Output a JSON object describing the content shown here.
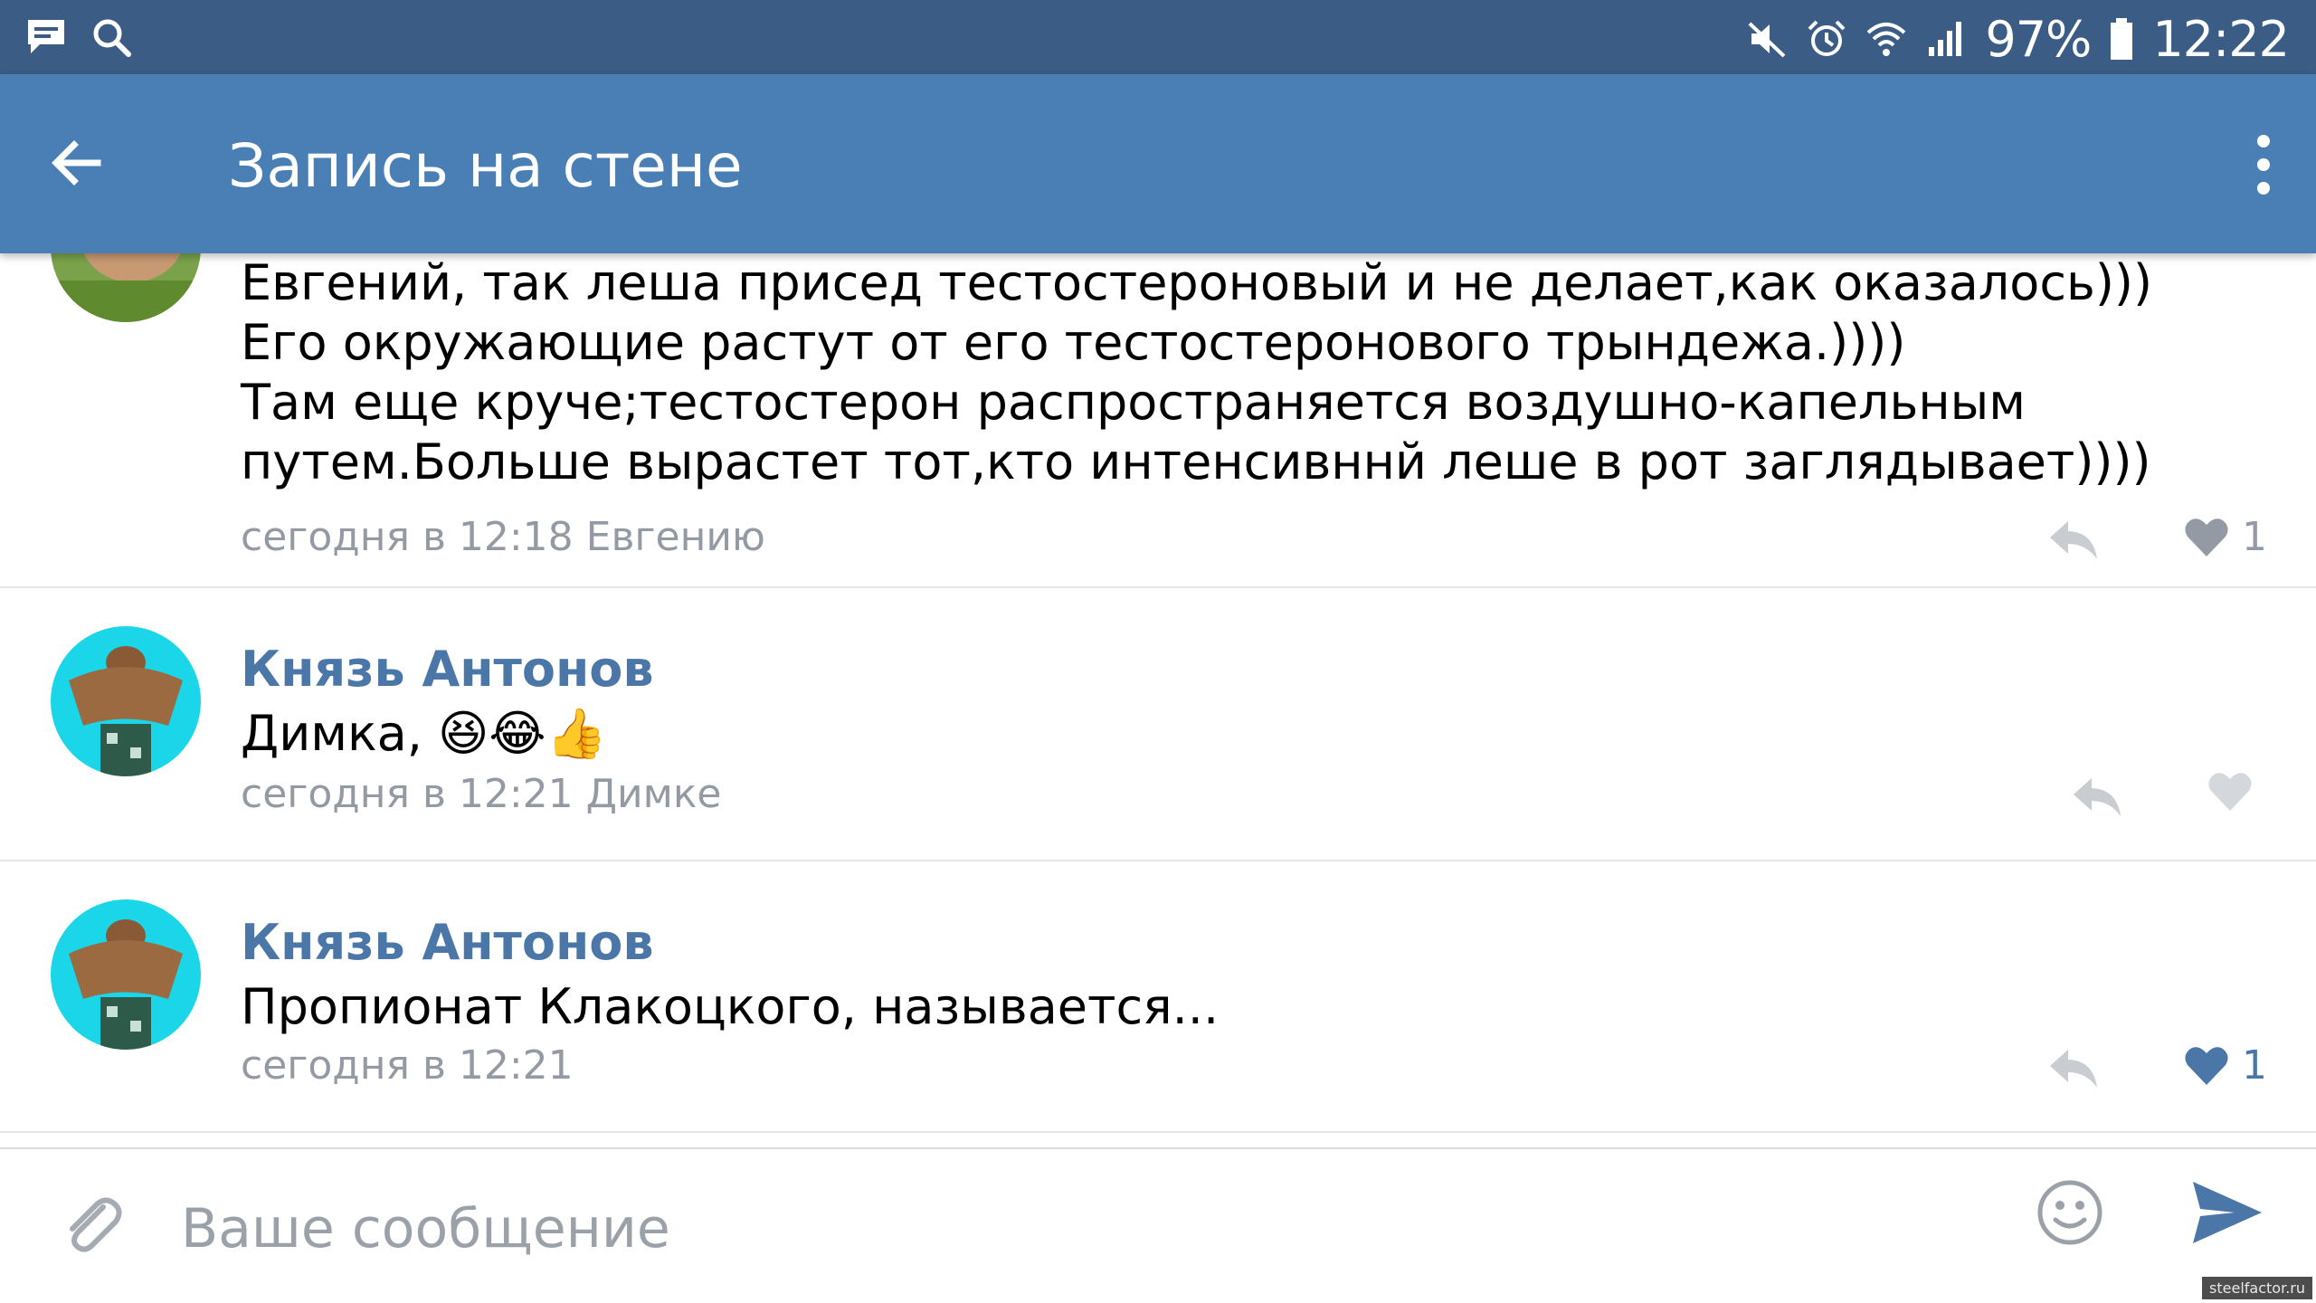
{
  "status_bar": {
    "battery": "97%",
    "time": "12:22",
    "icons": [
      "message-icon",
      "search-icon",
      "mute-icon",
      "alarm-icon",
      "wifi-icon",
      "signal-icon",
      "battery-icon"
    ]
  },
  "toolbar": {
    "title": "Запись на стене",
    "back_icon": "arrow-left-icon",
    "menu_icon": "more-vertical-icon",
    "color": "#4a7fb5"
  },
  "comments": [
    {
      "author": "",
      "text": "Евгений, так леша присед тестостероновый и не делает,как оказалось)))\nЕго окружающие растут от его тестостеронового трындежа.))))\nТам еще круче;тестостерон распространяется воздушно-капельным путем.Больше вырастет тот,кто интенсивннй леше в рот заглядывает))))",
      "meta": "сегодня в 12:18 Евгению",
      "likes": "1",
      "liked": false
    },
    {
      "author": "Князь Антонов",
      "text": "Димка, 😆😂👍",
      "meta": "сегодня в 12:21 Димке",
      "likes": "",
      "liked": false
    },
    {
      "author": "Князь Антонов",
      "text": "Пропионат Клакоцкого, называется...",
      "meta": "сегодня в 12:21",
      "likes": "1",
      "liked": true
    }
  ],
  "composer": {
    "placeholder": "Ваше сообщение",
    "icons": [
      "paperclip-icon",
      "smile-icon",
      "send-icon"
    ]
  },
  "watermark": "steelfactor.ru",
  "colors": {
    "status_bar": "#3a5c85",
    "author": "#4a76a8",
    "meta": "#939aa3",
    "like_active": "#4a76a8"
  }
}
